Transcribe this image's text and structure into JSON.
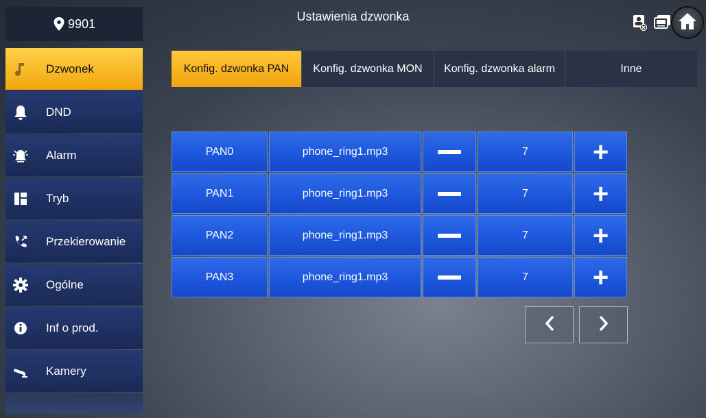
{
  "header": {
    "room_number": "9901",
    "title": "Ustawienia dzwonka"
  },
  "sidebar": {
    "items": [
      {
        "label": "Dzwonek",
        "icon": "music-note-icon",
        "active": true
      },
      {
        "label": "DND",
        "icon": "bell-icon",
        "active": false
      },
      {
        "label": "Alarm",
        "icon": "alarm-icon",
        "active": false
      },
      {
        "label": "Tryb",
        "icon": "mode-grid-icon",
        "active": false
      },
      {
        "label": "Przekierowanie",
        "icon": "call-forward-icon",
        "active": false
      },
      {
        "label": "Ogólne",
        "icon": "gear-icon",
        "active": false
      },
      {
        "label": "Inf o prod.",
        "icon": "info-icon",
        "active": false
      },
      {
        "label": "Kamery",
        "icon": "camera-icon",
        "active": false
      }
    ]
  },
  "tabs": [
    {
      "label": "Konfig. dzwonka PAN",
      "active": true
    },
    {
      "label": "Konfig. dzwonka MON",
      "active": false
    },
    {
      "label": "Konfig. dzwonka alarm",
      "active": false
    },
    {
      "label": "Inne",
      "active": false
    }
  ],
  "rows": [
    {
      "name": "PAN0",
      "file": "phone_ring1.mp3",
      "volume": "7"
    },
    {
      "name": "PAN1",
      "file": "phone_ring1.mp3",
      "volume": "7"
    },
    {
      "name": "PAN2",
      "file": "phone_ring1.mp3",
      "volume": "7"
    },
    {
      "name": "PAN3",
      "file": "phone_ring1.mp3",
      "volume": "7"
    }
  ],
  "colors": {
    "active_accent": "#f5ae14",
    "sidebar_bg": "#1f3060",
    "cell_bg": "#1d57dd"
  }
}
